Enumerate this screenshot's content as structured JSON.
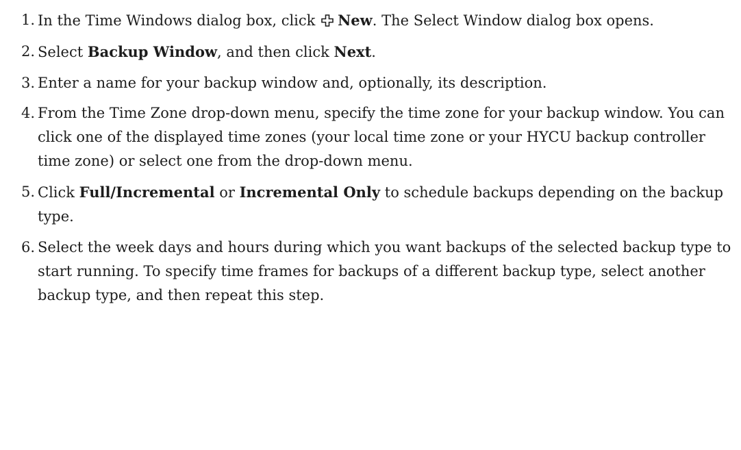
{
  "steps": [
    {
      "number": "1.",
      "parts": {
        "a": "In the Time Windows dialog box, click",
        "icon": "plus-icon",
        "b": "New",
        "c": ". The Select Window dialog box opens."
      }
    },
    {
      "number": "2.",
      "parts": {
        "a": "Select ",
        "b": "Backup Window",
        "c": ", and then click ",
        "d": "Next",
        "e": "."
      }
    },
    {
      "number": "3.",
      "text": "Enter a name for your backup window and, optionally, its description."
    },
    {
      "number": "4.",
      "text": "From the Time Zone drop-down menu, specify the time zone for your backup window. You can click one of the displayed time zones (your local time zone or your HYCU backup controller time zone) or select one from the drop-down menu."
    },
    {
      "number": "5.",
      "parts": {
        "a": "Click ",
        "b": "Full/Incremental",
        "c": " or ",
        "d": "Incremental Only",
        "e": " to schedule backups depending on the backup type."
      }
    },
    {
      "number": "6.",
      "text": "Select the week days and hours during which you want backups of the selected backup type to start running. To specify time frames for backups of a different backup type, select another backup type, and then repeat this step."
    }
  ]
}
